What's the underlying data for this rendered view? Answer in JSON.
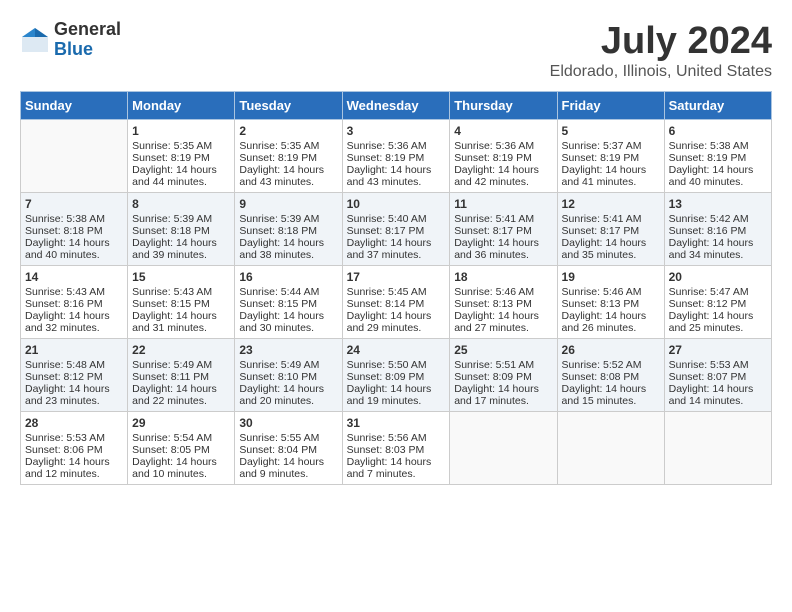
{
  "logo": {
    "general": "General",
    "blue": "Blue"
  },
  "title": "July 2024",
  "location": "Eldorado, Illinois, United States",
  "days_of_week": [
    "Sunday",
    "Monday",
    "Tuesday",
    "Wednesday",
    "Thursday",
    "Friday",
    "Saturday"
  ],
  "weeks": [
    [
      {
        "day": "",
        "sunrise": "",
        "sunset": "",
        "daylight": "",
        "empty": true
      },
      {
        "day": "1",
        "sunrise": "Sunrise: 5:35 AM",
        "sunset": "Sunset: 8:19 PM",
        "daylight": "Daylight: 14 hours and 44 minutes."
      },
      {
        "day": "2",
        "sunrise": "Sunrise: 5:35 AM",
        "sunset": "Sunset: 8:19 PM",
        "daylight": "Daylight: 14 hours and 43 minutes."
      },
      {
        "day": "3",
        "sunrise": "Sunrise: 5:36 AM",
        "sunset": "Sunset: 8:19 PM",
        "daylight": "Daylight: 14 hours and 43 minutes."
      },
      {
        "day": "4",
        "sunrise": "Sunrise: 5:36 AM",
        "sunset": "Sunset: 8:19 PM",
        "daylight": "Daylight: 14 hours and 42 minutes."
      },
      {
        "day": "5",
        "sunrise": "Sunrise: 5:37 AM",
        "sunset": "Sunset: 8:19 PM",
        "daylight": "Daylight: 14 hours and 41 minutes."
      },
      {
        "day": "6",
        "sunrise": "Sunrise: 5:38 AM",
        "sunset": "Sunset: 8:19 PM",
        "daylight": "Daylight: 14 hours and 40 minutes."
      }
    ],
    [
      {
        "day": "7",
        "sunrise": "Sunrise: 5:38 AM",
        "sunset": "Sunset: 8:18 PM",
        "daylight": "Daylight: 14 hours and 40 minutes."
      },
      {
        "day": "8",
        "sunrise": "Sunrise: 5:39 AM",
        "sunset": "Sunset: 8:18 PM",
        "daylight": "Daylight: 14 hours and 39 minutes."
      },
      {
        "day": "9",
        "sunrise": "Sunrise: 5:39 AM",
        "sunset": "Sunset: 8:18 PM",
        "daylight": "Daylight: 14 hours and 38 minutes."
      },
      {
        "day": "10",
        "sunrise": "Sunrise: 5:40 AM",
        "sunset": "Sunset: 8:17 PM",
        "daylight": "Daylight: 14 hours and 37 minutes."
      },
      {
        "day": "11",
        "sunrise": "Sunrise: 5:41 AM",
        "sunset": "Sunset: 8:17 PM",
        "daylight": "Daylight: 14 hours and 36 minutes."
      },
      {
        "day": "12",
        "sunrise": "Sunrise: 5:41 AM",
        "sunset": "Sunset: 8:17 PM",
        "daylight": "Daylight: 14 hours and 35 minutes."
      },
      {
        "day": "13",
        "sunrise": "Sunrise: 5:42 AM",
        "sunset": "Sunset: 8:16 PM",
        "daylight": "Daylight: 14 hours and 34 minutes."
      }
    ],
    [
      {
        "day": "14",
        "sunrise": "Sunrise: 5:43 AM",
        "sunset": "Sunset: 8:16 PM",
        "daylight": "Daylight: 14 hours and 32 minutes."
      },
      {
        "day": "15",
        "sunrise": "Sunrise: 5:43 AM",
        "sunset": "Sunset: 8:15 PM",
        "daylight": "Daylight: 14 hours and 31 minutes."
      },
      {
        "day": "16",
        "sunrise": "Sunrise: 5:44 AM",
        "sunset": "Sunset: 8:15 PM",
        "daylight": "Daylight: 14 hours and 30 minutes."
      },
      {
        "day": "17",
        "sunrise": "Sunrise: 5:45 AM",
        "sunset": "Sunset: 8:14 PM",
        "daylight": "Daylight: 14 hours and 29 minutes."
      },
      {
        "day": "18",
        "sunrise": "Sunrise: 5:46 AM",
        "sunset": "Sunset: 8:13 PM",
        "daylight": "Daylight: 14 hours and 27 minutes."
      },
      {
        "day": "19",
        "sunrise": "Sunrise: 5:46 AM",
        "sunset": "Sunset: 8:13 PM",
        "daylight": "Daylight: 14 hours and 26 minutes."
      },
      {
        "day": "20",
        "sunrise": "Sunrise: 5:47 AM",
        "sunset": "Sunset: 8:12 PM",
        "daylight": "Daylight: 14 hours and 25 minutes."
      }
    ],
    [
      {
        "day": "21",
        "sunrise": "Sunrise: 5:48 AM",
        "sunset": "Sunset: 8:12 PM",
        "daylight": "Daylight: 14 hours and 23 minutes."
      },
      {
        "day": "22",
        "sunrise": "Sunrise: 5:49 AM",
        "sunset": "Sunset: 8:11 PM",
        "daylight": "Daylight: 14 hours and 22 minutes."
      },
      {
        "day": "23",
        "sunrise": "Sunrise: 5:49 AM",
        "sunset": "Sunset: 8:10 PM",
        "daylight": "Daylight: 14 hours and 20 minutes."
      },
      {
        "day": "24",
        "sunrise": "Sunrise: 5:50 AM",
        "sunset": "Sunset: 8:09 PM",
        "daylight": "Daylight: 14 hours and 19 minutes."
      },
      {
        "day": "25",
        "sunrise": "Sunrise: 5:51 AM",
        "sunset": "Sunset: 8:09 PM",
        "daylight": "Daylight: 14 hours and 17 minutes."
      },
      {
        "day": "26",
        "sunrise": "Sunrise: 5:52 AM",
        "sunset": "Sunset: 8:08 PM",
        "daylight": "Daylight: 14 hours and 15 minutes."
      },
      {
        "day": "27",
        "sunrise": "Sunrise: 5:53 AM",
        "sunset": "Sunset: 8:07 PM",
        "daylight": "Daylight: 14 hours and 14 minutes."
      }
    ],
    [
      {
        "day": "28",
        "sunrise": "Sunrise: 5:53 AM",
        "sunset": "Sunset: 8:06 PM",
        "daylight": "Daylight: 14 hours and 12 minutes."
      },
      {
        "day": "29",
        "sunrise": "Sunrise: 5:54 AM",
        "sunset": "Sunset: 8:05 PM",
        "daylight": "Daylight: 14 hours and 10 minutes."
      },
      {
        "day": "30",
        "sunrise": "Sunrise: 5:55 AM",
        "sunset": "Sunset: 8:04 PM",
        "daylight": "Daylight: 14 hours and 9 minutes."
      },
      {
        "day": "31",
        "sunrise": "Sunrise: 5:56 AM",
        "sunset": "Sunset: 8:03 PM",
        "daylight": "Daylight: 14 hours and 7 minutes."
      },
      {
        "day": "",
        "sunrise": "",
        "sunset": "",
        "daylight": "",
        "empty": true
      },
      {
        "day": "",
        "sunrise": "",
        "sunset": "",
        "daylight": "",
        "empty": true
      },
      {
        "day": "",
        "sunrise": "",
        "sunset": "",
        "daylight": "",
        "empty": true
      }
    ]
  ]
}
